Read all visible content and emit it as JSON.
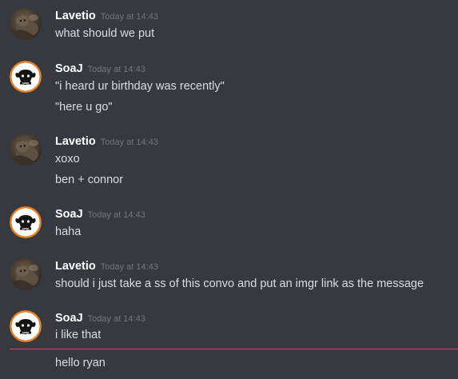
{
  "messages": [
    {
      "author": "Lavetio",
      "avatar_icon": "cat-photo-avatar",
      "timestamp": "Today at 14:43",
      "lines": [
        "what should we put"
      ]
    },
    {
      "author": "SoaJ",
      "avatar_icon": "ram-skull-logo-avatar",
      "timestamp": "Today at 14:43",
      "lines": [
        "\"i heard ur birthday was recently\"",
        "\"here u go\""
      ]
    },
    {
      "author": "Lavetio",
      "avatar_icon": "cat-photo-avatar",
      "timestamp": "Today at 14:43",
      "lines": [
        "xoxo",
        "ben + connor"
      ]
    },
    {
      "author": "SoaJ",
      "avatar_icon": "ram-skull-logo-avatar",
      "timestamp": "Today at 14:43",
      "lines": [
        "haha"
      ]
    },
    {
      "author": "Lavetio",
      "avatar_icon": "cat-photo-avatar",
      "timestamp": "Today at 14:43",
      "lines": [
        "should i just take a ss of this convo and put an imgr link as the message"
      ]
    },
    {
      "author": "SoaJ",
      "avatar_icon": "ram-skull-logo-avatar",
      "timestamp": "Today at 14:43",
      "lines": [
        "i like that",
        "hello ryan"
      ]
    }
  ],
  "colors": {
    "background": "#36393f",
    "username": "#ffffff",
    "text": "#dcddde",
    "timestamp": "#72767d",
    "new_messages_divider": "#f04747",
    "soaj_avatar_ring": "#e67e22"
  }
}
